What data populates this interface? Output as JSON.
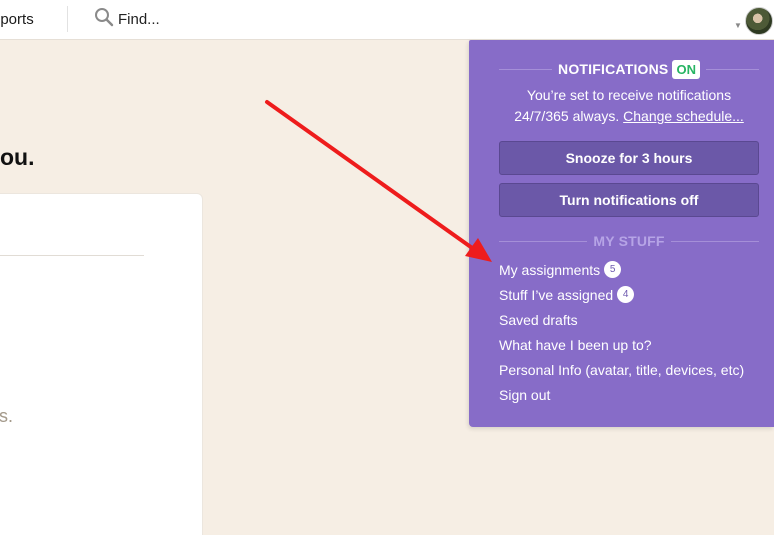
{
  "topbar": {
    "nav_reports_label": "eports",
    "find_label": "Find...",
    "search_icon": "search-icon",
    "avatar_icon": "user-avatar",
    "caret_icon": "chevron-down-icon"
  },
  "page": {
    "heading_fragment": "ou.",
    "card_text_fragment": "s."
  },
  "annotation": {
    "arrow_color": "#ee1c1c"
  },
  "dropdown": {
    "background": "#876cc8",
    "notifications": {
      "title": "NOTIFICATIONS",
      "status_badge": "ON",
      "status_color": "#27b463",
      "message_line1": "You’re set to receive notifications",
      "message_line2_prefix": "24/7/365 always.",
      "change_schedule_link": "Change schedule..."
    },
    "buttons": {
      "snooze_label": "Snooze for 3 hours",
      "turn_off_label": "Turn notifications off"
    },
    "my_stuff": {
      "title": "MY STUFF",
      "items": [
        {
          "label": "My assignments",
          "count": "5"
        },
        {
          "label": "Stuff I’ve assigned",
          "count": "4"
        },
        {
          "label": "Saved drafts"
        },
        {
          "label": "What have I been up to?"
        },
        {
          "label": "Personal Info (avatar, title, devices, etc)"
        },
        {
          "label": "Sign out"
        }
      ]
    }
  }
}
